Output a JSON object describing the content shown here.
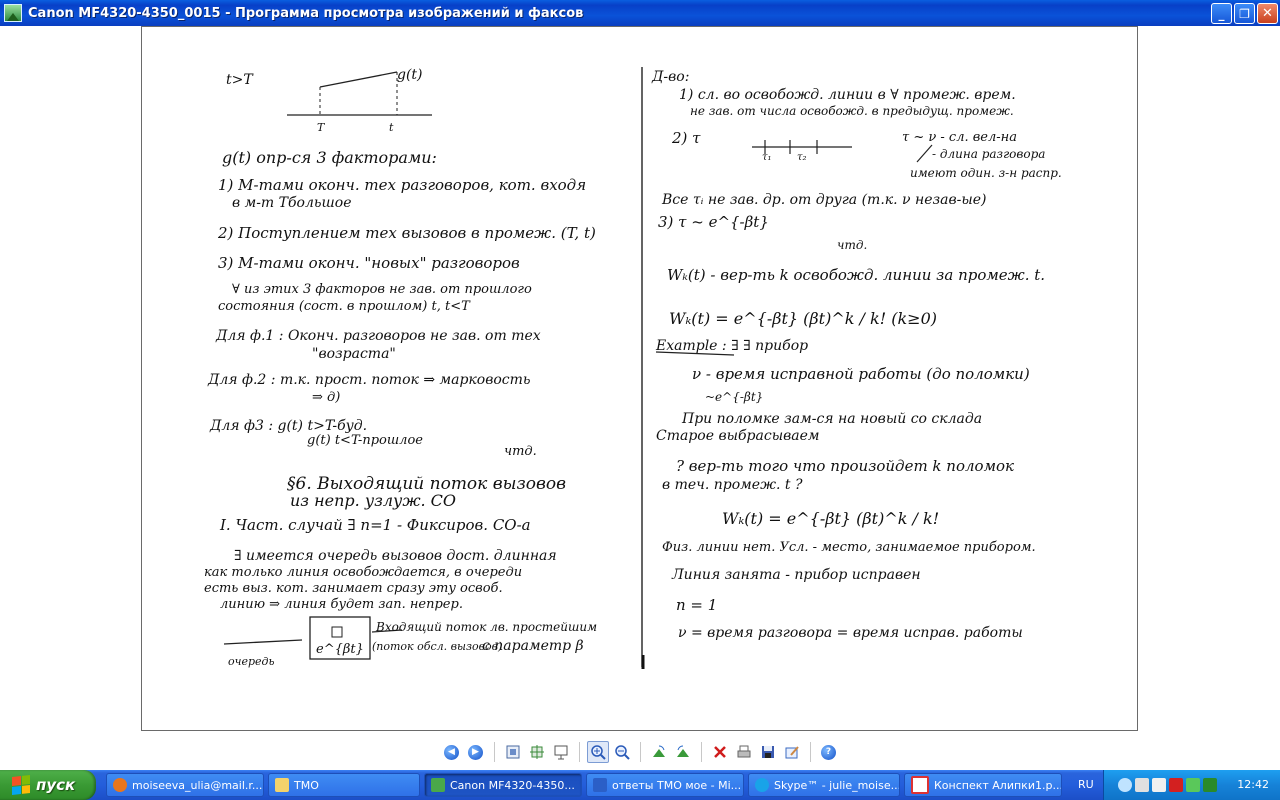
{
  "window": {
    "title": "Canon MF4320-4350_0015 - Программа просмотра изображений и факсов",
    "minimize": "_",
    "maximize": "❐",
    "close": "✕"
  },
  "document": {
    "left_column": [
      "t>T",
      "g(t)",
      "T",
      "t",
      "g(t) опр-ся 3 факторами:",
      "1) M-тами оконч. тех разговоров, кот. входя",
      "в м-т Тбольшое",
      "2) Поступлением тех вызовов в промеж. (T, t)",
      "3) M-тами оконч. \"новых\" разговоров",
      "∀ из этих 3 факторов не зав. от прошлого",
      "состояния (сост. в прошлом) t, t<T",
      "Для ф.1 : Оконч. разговоров не зав. от тех",
      "\"возраста\"",
      "Для ф.2 : т.к. прост. поток ⇒ марковость",
      "⇒ д)",
      "Для ф3 : g(t) t>T-буд.",
      "g(t) t<T-прошлое",
      "чтд.",
      "§6. Выходящий поток вызовов",
      "из непр. узлуж. СО",
      "I. Част. случай ∃ n=1 - Фиксиров. СО-а",
      "∃ имеется очередь вызовов дост. длинная",
      "как только линия освобождается, в очереди",
      "есть выз. кот. занимает сразу эту освоб.",
      "линию ⇒ линия будет зап. непрер.",
      "Входящий поток лв. простейшим",
      "(поток обсл. вызовов)",
      "c параметр β",
      "e^{βt}",
      "очередь"
    ],
    "right_column": [
      "Д-во:",
      "1) сл. во освобожд. линии в ∀ промеж. врем.",
      "не зав. от числа освобожд. в предыдущ. промеж.",
      "2) τ",
      "τ₁",
      "τ₂",
      "τ ~ ν - сл. вел-на",
      "- длина разговора",
      "имеют один. з-н распр.",
      "Все τᵢ не зав. др. от друга (т.к. ν незав-ые)",
      "3) τ ~ e^{-βt}",
      "чтд.",
      "Wₖ(t) - вер-ть k освобожд. линии за промеж. t.",
      "Wₖ(t) = e^{-βt} (βt)^k / k!   (k≥0)",
      "Example : ∃ ∃ прибор",
      "ν - время исправной работы (до поломки)",
      "~e^{-βt}",
      "При поломке зам-ся на новый со склада",
      "Старое выбрасываем",
      "? вер-ть того что произойдет k поломок",
      "в теч. промеж. t ?",
      "Wₖ(t) = e^{-βt} (βt)^k / k!",
      "Физ. линии нет. Усл. - место, занимаемое прибором.",
      "Линия занята - прибор исправен",
      "n = 1",
      "ν = время разговора = время исправ. работы"
    ]
  },
  "toolbar": {
    "items": [
      "prev-image-icon",
      "next-image-icon",
      "best-fit-icon",
      "actual-size-icon",
      "slideshow-icon",
      "zoom-in-icon",
      "zoom-out-icon",
      "rotate-cw-icon",
      "rotate-ccw-icon",
      "delete-icon",
      "print-icon",
      "save-icon",
      "edit-icon",
      "help-icon"
    ]
  },
  "taskbar": {
    "start_label": "пуск",
    "tasks": [
      {
        "label": "moiseeva_ulia@mail.r...",
        "icon": "firefox-icon",
        "color": "#e8761e"
      },
      {
        "label": "ТМО",
        "icon": "folder-icon",
        "color": "#f3d26b"
      },
      {
        "label": "Canon MF4320-4350...",
        "icon": "image-viewer-icon",
        "color": "#4aa84a"
      },
      {
        "label": "ответы ТМО мое - Mi...",
        "icon": "word-icon",
        "color": "#2b5fc7"
      },
      {
        "label": "Skype™ - julie_moise...",
        "icon": "skype-icon",
        "color": "#19a3e8"
      },
      {
        "label": "Конспект Алипки1.р...",
        "icon": "pdf-icon",
        "color": "#d33"
      }
    ],
    "language": "RU",
    "clock": "12:42"
  }
}
